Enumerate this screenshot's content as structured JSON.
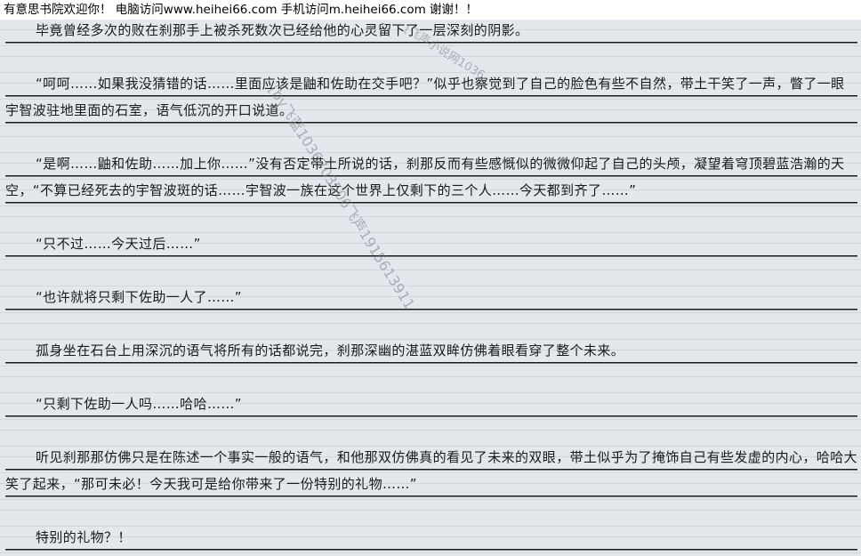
{
  "header": {
    "banner": "有意思书院欢迎你！  电脑访问www.heihei66.com   手机访问m.heihei66.com  谢谢！！"
  },
  "watermarks": {
    "diagonal": "[by飞蓝1036703506飞声1915613911",
    "top": "[飞声小说网1036"
  },
  "paragraphs": [
    {
      "text": "毕竟曾经多次的败在刹那手上被杀死数次已经给他的心灵留下了一层深刻的阴影。"
    },
    {
      "text": "“呵呵……如果我没猜错的话……里面应该是鼬和佐助在交手吧？”似乎也察觉到了自己的脸色有些不自然，带土干笑了一声，瞥了一眼宇智波驻地里面的石室，语气低沉的开口说道。"
    },
    {
      "text": "“是啊……鼬和佐助……加上你……”没有否定带土所说的话，刹那反而有些感慨似的微微仰起了自己的头颅，凝望着穹顶碧蓝浩瀚的天空，“不算已经死去的宇智波斑的话……宇智波一族在这个世界上仅剩下的三个人……今天都到齐了……”"
    },
    {
      "text": "“只不过……今天过后……”"
    },
    {
      "text": "“也许就将只剩下佐助一人了……”"
    },
    {
      "text": "孤身坐在石台上用深沉的语气将所有的话都说完，刹那深幽的湛蓝双眸仿佛着眼看穿了整个未来。"
    },
    {
      "text": "“只剩下佐助一人吗……哈哈……”"
    },
    {
      "text": "听见刹那那仿佛只是在陈述一个事实一般的语气，和他那双仿佛真的看见了未来的双眼，带土似乎为了掩饰自己有些发虚的内心，哈哈大笑了起来，“那可未必！今天我可是给你带来了一份特别的礼物……”"
    },
    {
      "text": "特别的礼物？！"
    }
  ]
}
